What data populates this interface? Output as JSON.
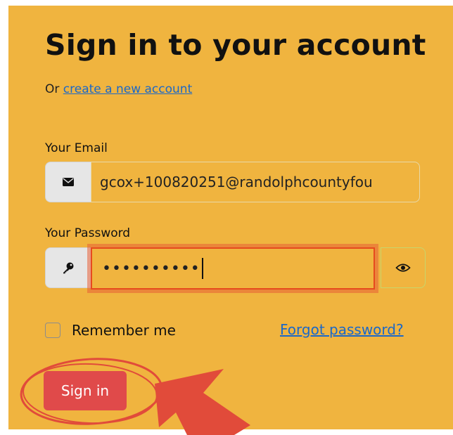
{
  "heading": "Sign in to your account",
  "subtitle": {
    "prefix": "Or",
    "link": "create a new account"
  },
  "email": {
    "label": "Your Email",
    "value": "gcox+100820251@randolphcountyfou",
    "icon": "envelope-icon"
  },
  "password": {
    "label": "Your Password",
    "masked_value": "••••••••••",
    "icon": "key-icon",
    "toggle_icon": "eye-icon"
  },
  "remember": {
    "label": "Remember me",
    "checked": false
  },
  "forgot_link": "Forgot password?",
  "sign_in_button": "Sign in",
  "colors": {
    "panel_background": "#f0b43f",
    "button": "#e04a4a",
    "link": "#1a68c9",
    "focus_ring": "#e64a1e",
    "annotation": "#e14b3a"
  },
  "annotations": {
    "circle_around": "sign-in-button",
    "arrow_pointing_to": "sign-in-button"
  }
}
